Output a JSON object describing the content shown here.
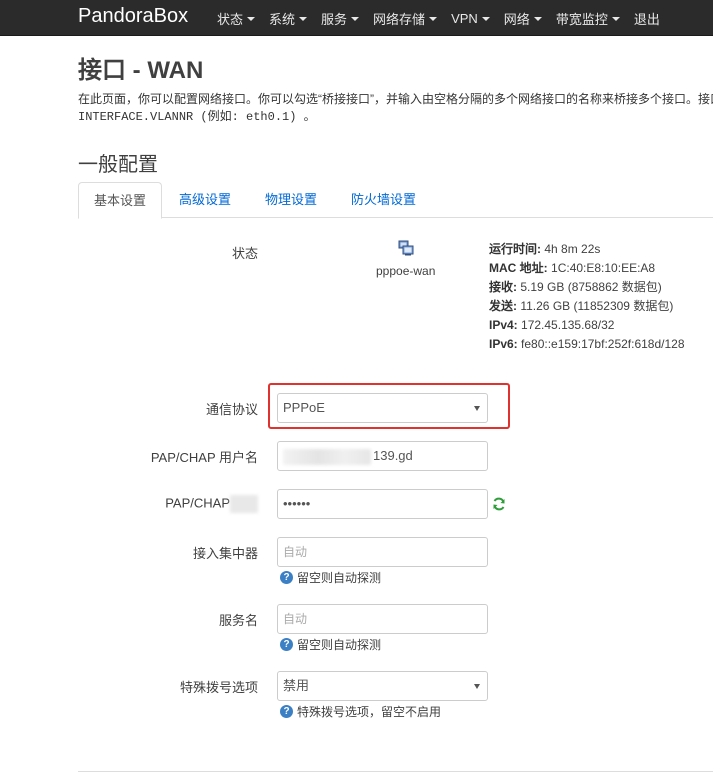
{
  "navbar": {
    "brand": "PandoraBox",
    "items": [
      {
        "label": "状态",
        "caret": true
      },
      {
        "label": "系统",
        "caret": true
      },
      {
        "label": "服务",
        "caret": true
      },
      {
        "label": "网络存储",
        "caret": true
      },
      {
        "label": "VPN",
        "caret": true
      },
      {
        "label": "网络",
        "caret": true
      },
      {
        "label": "带宽监控",
        "caret": true
      },
      {
        "label": "退出",
        "caret": false
      }
    ]
  },
  "page": {
    "title": "接口 - WAN",
    "description_line1": "在此页面，你可以配置网络接口。你可以勾选“桥接接口”，并输入由空格分隔的多个网络接口的名称来桥接多个接口。接口名称中的点“.”用于VLAN",
    "description_line2": "INTERFACE.VLANNR (例如: eth0.1) 。"
  },
  "section": {
    "title": "一般配置",
    "tabs": [
      "基本设置",
      "高级设置",
      "物理设置",
      "防火墙设置"
    ],
    "active_tab": 0
  },
  "status": {
    "label": "状态",
    "interface_name": "pppoe-wan",
    "icon": "network-interface-icon",
    "uptime_label": "运行时间:",
    "uptime_value": "4h 8m 22s",
    "mac_label": "MAC 地址:",
    "mac_value": "1C:40:E8:10:EE:A8",
    "rx_label": "接收:",
    "rx_value": "5.19 GB (8758862 数据包)",
    "tx_label": "发送:",
    "tx_value": "11.26 GB (11852309 数据包)",
    "ipv4_label": "IPv4:",
    "ipv4_value": "172.45.135.68/32",
    "ipv6_label": "IPv6:",
    "ipv6_value": "fe80::e159:17bf:252f:618d/128"
  },
  "form": {
    "protocol_label": "通信协议",
    "protocol_value": "PPPoE",
    "username_label": "PAP/CHAP 用户名",
    "username_value_visible": "139.gd",
    "password_label": "PAP/CHAP",
    "password_value": "••••••",
    "ac_label": "接入集中器",
    "ac_placeholder": "自动",
    "ac_hint": "留空则自动探测",
    "service_label": "服务名",
    "service_placeholder": "自动",
    "service_hint": "留空则自动探测",
    "dial_label": "特殊拨号选项",
    "dial_value": "禁用",
    "dial_hint": "特殊拨号选项，留空不启用"
  },
  "colors": {
    "navbar_bg": "#2b2b2b",
    "link": "#0069d6",
    "highlight": "#e0322e",
    "hint_icon": "#3b7fc4"
  }
}
